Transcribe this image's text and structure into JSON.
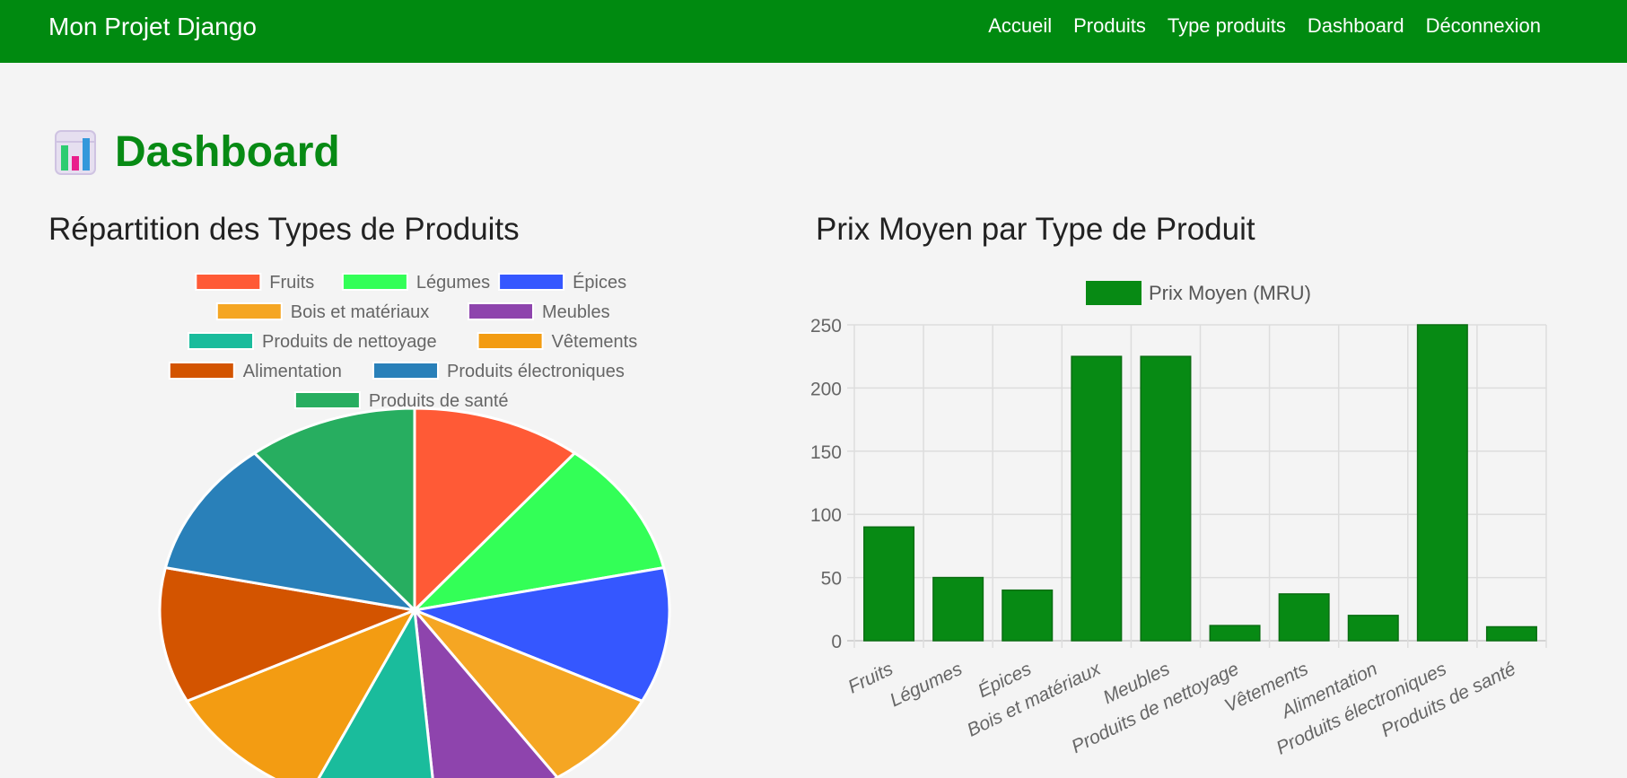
{
  "navbar": {
    "brand": "Mon Projet Django",
    "links": [
      "Accueil",
      "Produits",
      "Type produits",
      "Dashboard",
      "Déconnexion"
    ]
  },
  "page": {
    "title": "Dashboard",
    "title_icon": "bar-chart-icon"
  },
  "colors": {
    "navbar": "#008a10",
    "title": "#078a14",
    "bar": "#078a14"
  },
  "chart_data": [
    {
      "type": "pie",
      "title": "Répartition des Types de Produits",
      "legend_position": "top",
      "categories": [
        "Fruits",
        "Légumes",
        "Épices",
        "Bois et matériaux",
        "Meubles",
        "Produits de nettoyage",
        "Vêtements",
        "Alimentation",
        "Produits électroniques",
        "Produits de santé"
      ],
      "values": [
        1,
        1,
        1,
        0.75,
        0.75,
        0.75,
        1,
        1,
        1,
        1
      ],
      "colors": [
        "#ff5a36",
        "#33ff57",
        "#3557ff",
        "#f5a623",
        "#8e44ad",
        "#1abc9c",
        "#f39c12",
        "#d35400",
        "#2980b9",
        "#27ae60"
      ]
    },
    {
      "type": "bar",
      "title": "Prix Moyen par Type de Produit",
      "categories": [
        "Fruits",
        "Légumes",
        "Épices",
        "Bois et matériaux",
        "Meubles",
        "Produits de nettoyage",
        "Vêtements",
        "Alimentation",
        "Produits électroniques",
        "Produits de santé"
      ],
      "series": [
        {
          "name": "Prix Moyen (MRU)",
          "values": [
            90,
            50,
            40,
            225,
            225,
            12,
            37,
            20,
            250,
            11
          ]
        }
      ],
      "ylim": [
        0,
        250
      ],
      "yticks": [
        0,
        50,
        100,
        150,
        200,
        250
      ],
      "grid": true,
      "legend_position": "top"
    }
  ]
}
